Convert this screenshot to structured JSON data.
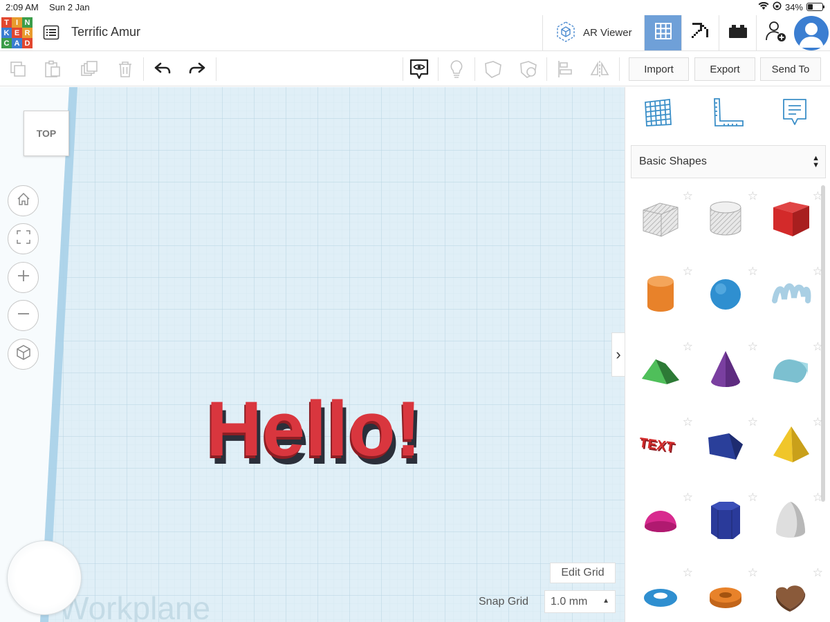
{
  "status_bar": {
    "time": "2:09 AM",
    "date": "Sun 2 Jan",
    "battery": "34%",
    "battery_level": 0.34
  },
  "logo": {
    "letters": [
      "T",
      "I",
      "N",
      "K",
      "E",
      "R",
      "C",
      "A",
      "D"
    ],
    "colors": [
      "#e2472f",
      "#e89b2e",
      "#3b9d4a",
      "#3b7ed1",
      "#e2472f",
      "#e89b2e",
      "#3b9d4a",
      "#3b7ed1",
      "#e2472f"
    ]
  },
  "header": {
    "design_title": "Terrific Amur",
    "ar_viewer_label": "AR Viewer",
    "buttons": [
      "grid-view",
      "pickaxe-blocks",
      "bricks",
      "invite-user",
      "account"
    ]
  },
  "toolbar": {
    "icons_left": [
      "copy-icon",
      "paste-icon",
      "duplicate-icon",
      "delete-icon"
    ],
    "undo": "undo-icon",
    "redo": "redo-icon",
    "icons_right": [
      "note-visibility-icon",
      "bulb-icon",
      "solid-shape-icon",
      "hole-shape-icon",
      "align-icon",
      "mirror-icon"
    ],
    "import_label": "Import",
    "export_label": "Export",
    "send_to_label": "Send To"
  },
  "canvas": {
    "view_cube_label": "TOP",
    "nav_buttons": [
      "home-icon",
      "fit-view-icon",
      "zoom-in-icon",
      "zoom-out-icon",
      "ortho-view-icon"
    ],
    "text_object": "Hello!",
    "text_color": "#d9363e",
    "workplane_label": "Workplane",
    "edit_grid_label": "Edit Grid",
    "snap_grid_label": "Snap Grid",
    "snap_grid_value": "1.0 mm"
  },
  "panel": {
    "icons": [
      "workplane-icon",
      "ruler-icon",
      "notes-icon"
    ],
    "category": "Basic Shapes",
    "shapes": [
      {
        "name": "box-hole",
        "color": "#c8c8c8"
      },
      {
        "name": "cylinder-hole",
        "color": "#c8c8c8"
      },
      {
        "name": "box",
        "color": "#d32a2a"
      },
      {
        "name": "cylinder",
        "color": "#e8822a"
      },
      {
        "name": "sphere",
        "color": "#2f8fd0"
      },
      {
        "name": "scribble",
        "color": "#a9cfe4"
      },
      {
        "name": "roof",
        "color": "#3fa34a"
      },
      {
        "name": "cone",
        "color": "#7a3fa0"
      },
      {
        "name": "round-roof",
        "color": "#7cc0d0"
      },
      {
        "name": "text",
        "color": "#d32a2a"
      },
      {
        "name": "wedge",
        "color": "#2a3f9a"
      },
      {
        "name": "pyramid",
        "color": "#f0c62a"
      },
      {
        "name": "half-sphere",
        "color": "#d82a8f"
      },
      {
        "name": "polygon",
        "color": "#2a3a9a"
      },
      {
        "name": "paraboloid",
        "color": "#dedede"
      },
      {
        "name": "torus",
        "color": "#2f8fd0"
      },
      {
        "name": "tube",
        "color": "#e8822a"
      },
      {
        "name": "heart",
        "color": "#8a5a3a"
      }
    ]
  }
}
